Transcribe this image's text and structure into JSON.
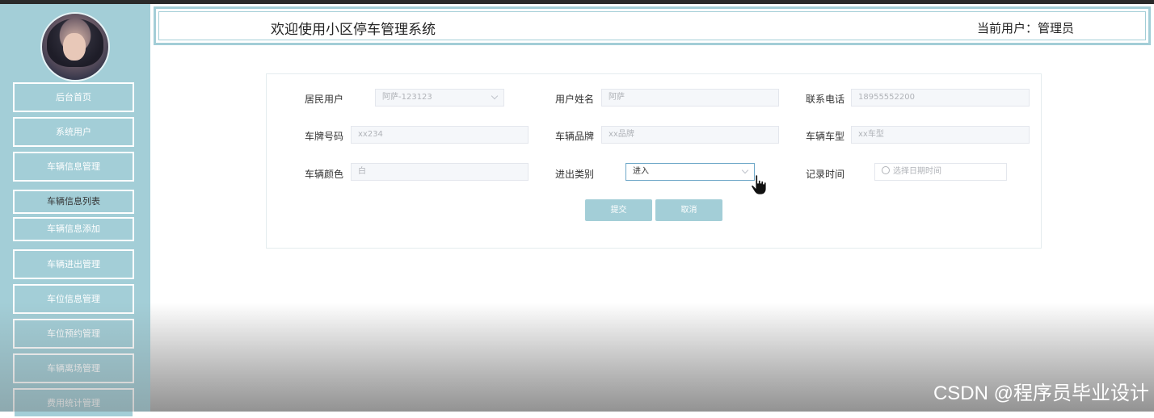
{
  "header": {
    "title": "欢迎使用小区停车管理系统",
    "current_user": "当前用户：管理员"
  },
  "sidebar": {
    "items": [
      {
        "label": "后台首页"
      },
      {
        "label": "系统用户"
      },
      {
        "label": "车辆信息管理"
      },
      {
        "label": "车辆信息列表"
      },
      {
        "label": "车辆信息添加"
      },
      {
        "label": "车辆进出管理"
      },
      {
        "label": "车位信息管理"
      },
      {
        "label": "车位预约管理"
      },
      {
        "label": "车辆离场管理"
      },
      {
        "label": "费用统计管理"
      }
    ]
  },
  "form": {
    "resident_user": {
      "label": "居民用户",
      "value": "阿萨-123123"
    },
    "user_name": {
      "label": "用户姓名",
      "value": "阿萨"
    },
    "phone": {
      "label": "联系电话",
      "value": "18955552200"
    },
    "plate_number": {
      "label": "车牌号码",
      "value": "xx234"
    },
    "vehicle_brand": {
      "label": "车辆品牌",
      "value": "xx品牌"
    },
    "vehicle_model": {
      "label": "车辆车型",
      "value": "xx车型"
    },
    "vehicle_color": {
      "label": "车辆颜色",
      "value": "白"
    },
    "entry_type": {
      "label": "进出类别",
      "value": "进入"
    },
    "record_time": {
      "label": "记录时间",
      "placeholder": "选择日期时间"
    }
  },
  "buttons": {
    "submit": "提交",
    "cancel": "取消"
  },
  "watermark": "CSDN @程序员毕业设计",
  "colors": {
    "accent": "#a3ced7",
    "active_border": "#6fa8c8"
  }
}
